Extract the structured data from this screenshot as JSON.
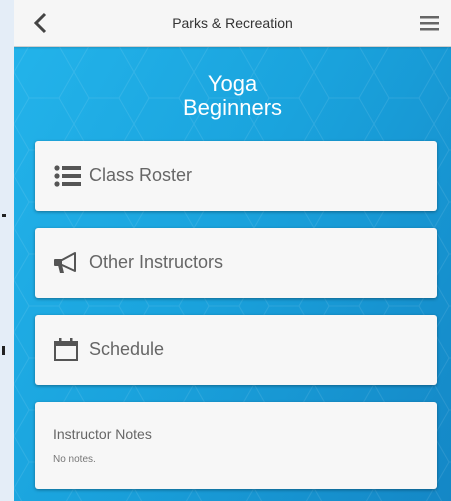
{
  "header": {
    "title": "Parks & Recreation",
    "back_icon": "chevron-left-icon",
    "menu_icon": "hamburger-menu-icon"
  },
  "class": {
    "title_line1": "Yoga",
    "title_line2": "Beginners"
  },
  "cards": {
    "roster": {
      "label": "Class Roster",
      "icon": "list-icon"
    },
    "instructors": {
      "label": "Other Instructors",
      "icon": "megaphone-icon"
    },
    "schedule": {
      "label": "Schedule",
      "icon": "calendar-icon"
    }
  },
  "notes": {
    "label": "Instructor Notes",
    "text": "No notes."
  },
  "colors": {
    "background_blue": "#1a9fda",
    "card": "#f7f7f7",
    "header": "#f6f6f6",
    "text_gray": "#666666"
  }
}
